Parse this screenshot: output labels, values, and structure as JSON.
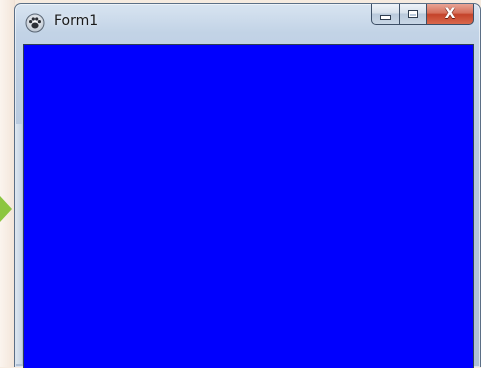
{
  "window": {
    "title": "Form1",
    "app_icon": "paw-icon",
    "client_color": "#0000fe",
    "caption_buttons": {
      "minimize_icon": "minimize-icon",
      "maximize_icon": "maximize-icon",
      "close_icon": "close-icon",
      "close_label": "X"
    }
  },
  "background": {
    "arrow_color": "#8cc640"
  }
}
